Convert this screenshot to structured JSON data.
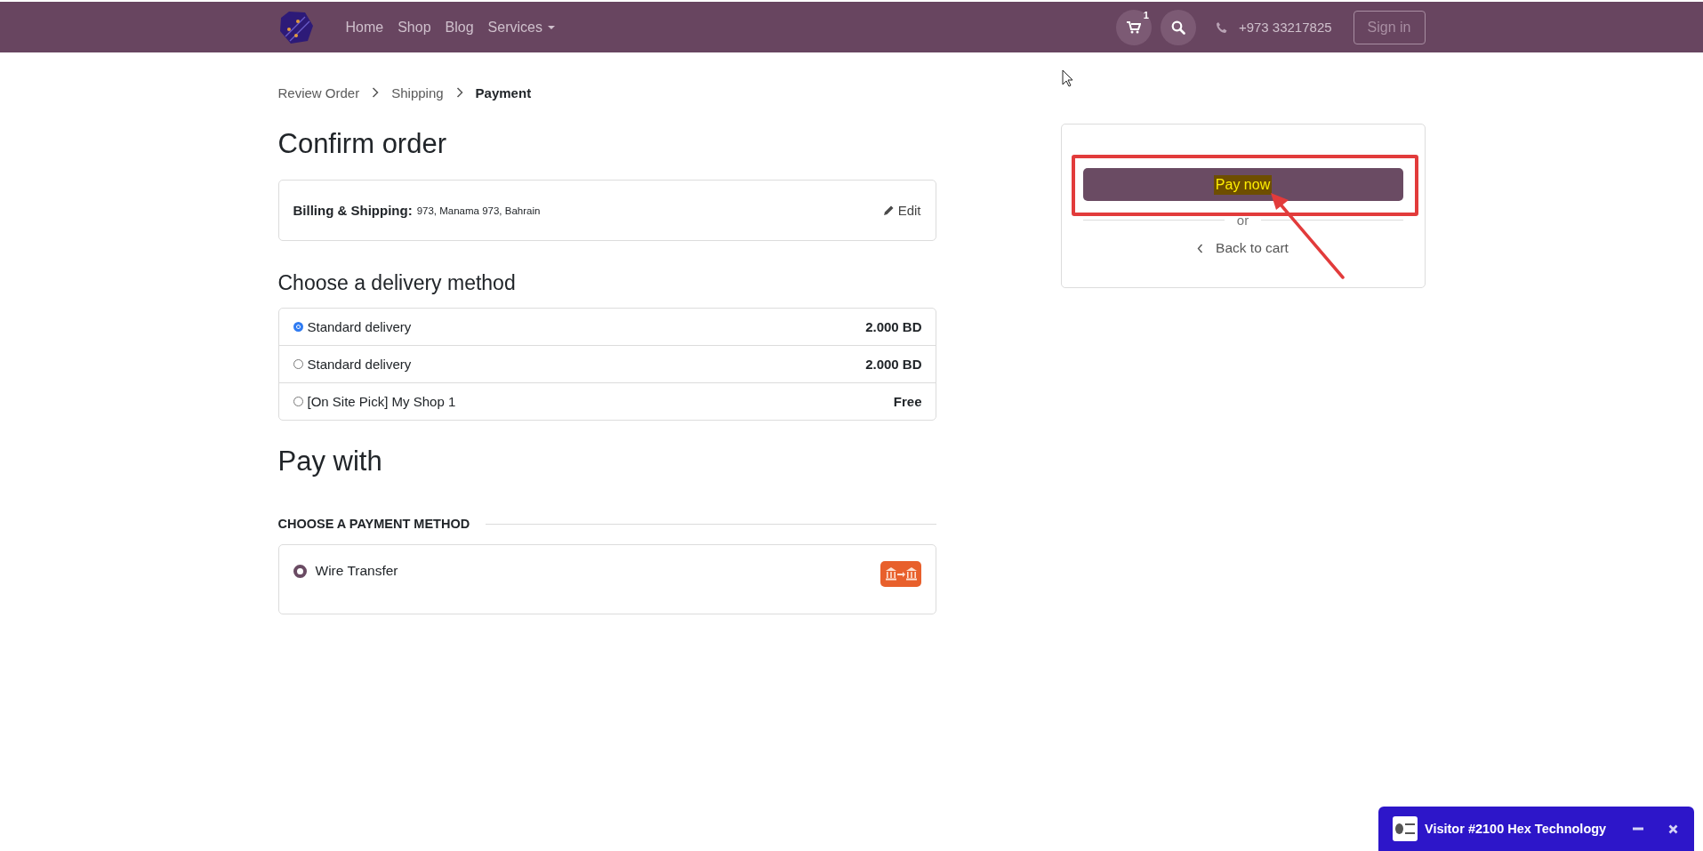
{
  "navbar": {
    "links": [
      {
        "label": "Home",
        "dropdown": false
      },
      {
        "label": "Shop",
        "dropdown": false
      },
      {
        "label": "Blog",
        "dropdown": false
      },
      {
        "label": "Services",
        "dropdown": true
      }
    ],
    "cart_count": "1",
    "phone": "+973 33217825",
    "sign_in": "Sign in"
  },
  "breadcrumb": [
    {
      "label": "Review Order",
      "current": false
    },
    {
      "label": "Shipping",
      "current": false
    },
    {
      "label": "Payment",
      "current": true
    }
  ],
  "title": "Confirm order",
  "billing": {
    "label": "Billing & Shipping:",
    "address": "973, Manama 973, Bahrain",
    "edit": "Edit"
  },
  "delivery": {
    "heading": "Choose a delivery method",
    "options": [
      {
        "label": "Standard delivery",
        "price": "2.000 BD",
        "selected": true
      },
      {
        "label": "Standard delivery",
        "price": "2.000 BD",
        "selected": false
      },
      {
        "label": "[On Site Pick] My Shop 1",
        "price": "Free",
        "selected": false
      }
    ]
  },
  "payment": {
    "heading": "Pay with",
    "section_label": "CHOOSE A PAYMENT METHOD",
    "methods": [
      {
        "label": "Wire Transfer",
        "selected": true
      }
    ]
  },
  "summary": {
    "pay_button": "Pay now",
    "separator": "or",
    "back": "Back to cart"
  },
  "chat": {
    "title": "Visitor #2100 Hex Technology"
  }
}
